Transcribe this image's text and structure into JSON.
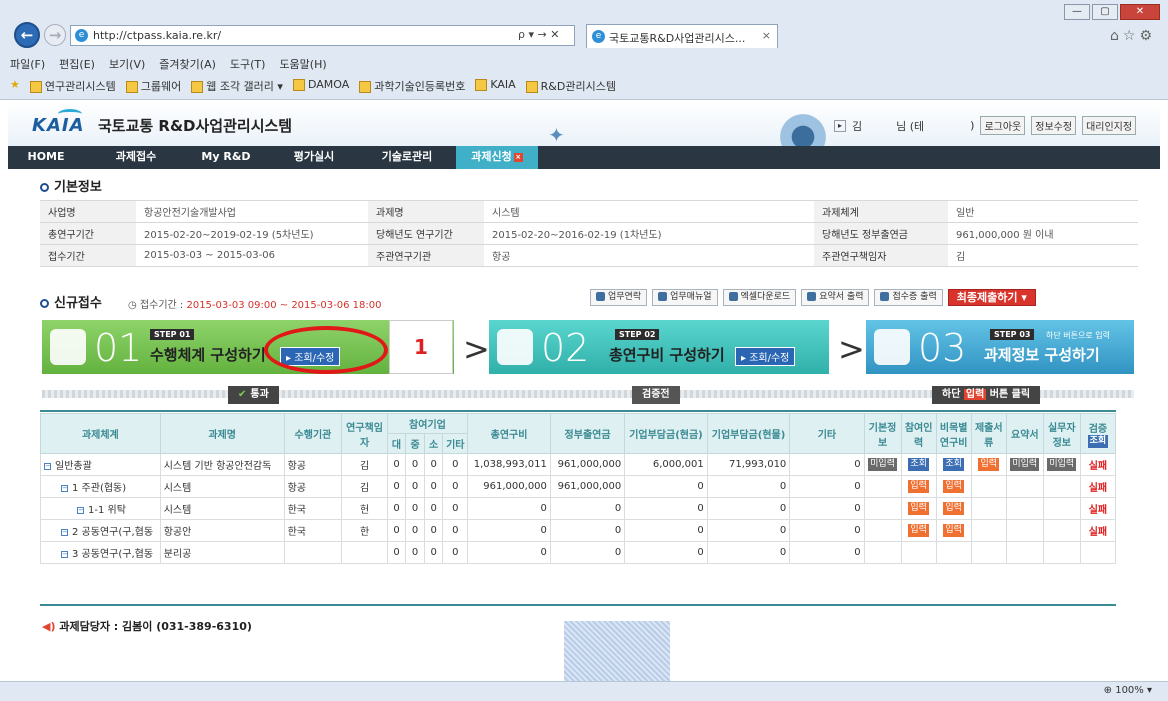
{
  "browser": {
    "url": "http://ctpass.kaia.re.kr/",
    "addr_tools": "ρ ▾ → ✕",
    "tab_title": "국토교통R&D사업관리시스...",
    "menu": [
      "파일(F)",
      "편집(E)",
      "보기(V)",
      "즐겨찾기(A)",
      "도구(T)",
      "도움말(H)"
    ],
    "favorites": [
      "연구관리시스템",
      "그룹웨어",
      "웹 조각 갤러리 ▾",
      "DAMOA",
      "과학기술인등록번호",
      "KAIA",
      "R&D관리시스템"
    ],
    "zoom": "100%"
  },
  "site": {
    "logo": "KAIA",
    "title": "국토교통 R&D사업관리시스템",
    "user_prefix": "김",
    "user_suffix": "님 (테",
    "user_close": ")",
    "logout": "로그아웃",
    "edit_info": "정보수정",
    "proxy": "대리인지정"
  },
  "nav": [
    "HOME",
    "과제접수",
    "My R&D",
    "평가실시",
    "기술로관리",
    "과제신청"
  ],
  "basic_info": {
    "heading": "기본정보",
    "rows": [
      [
        "사업명",
        "항공안전기술개발사업",
        "과제명",
        "시스템",
        "과제체계",
        "일반"
      ],
      [
        "총연구기간",
        "2015-02-20~2019-02-19 (5차년도)",
        "당해년도 연구기간",
        "2015-02-20~2016-02-19 (1차년도)",
        "당해년도 정부출연금",
        "961,000,000 원 이내"
      ],
      [
        "접수기간",
        "2015-03-03 ~ 2015-03-06",
        "주관연구기관",
        "항공",
        "주관연구책임자",
        "김"
      ]
    ]
  },
  "new_submission": {
    "heading": "신규접수",
    "period_label": "접수기간 :",
    "period_value": "2015-03-03 09:00 ~ 2015-03-06 18:00",
    "tools": [
      "업무연락",
      "업무매뉴얼",
      "엑셀다운로드",
      "요약서 출력",
      "접수증 출력"
    ],
    "final_submit": "최종제출하기"
  },
  "steps": [
    {
      "num": "01",
      "tag": "STEP 01",
      "title": "수행체계 구성하기",
      "button": "조회/수정",
      "status": "통과"
    },
    {
      "num": "02",
      "tag": "STEP 02",
      "title": "총연구비 구성하기",
      "button": "조회/수정",
      "status": "검증전"
    },
    {
      "num": "03",
      "tag": "STEP 03",
      "tag_note": "하단 버튼으로 입력",
      "title": "과제정보 구성하기",
      "status_pre": "하단",
      "status_mid": "입력",
      "status_post": "버튼 클릭"
    }
  ],
  "annotation_number": "1",
  "table": {
    "headers": [
      "과제체계",
      "과제명",
      "수행기관",
      "연구책임자",
      "참여기업",
      "총연구비",
      "정부출연금",
      "기업부담금(현금)",
      "기업부담금(현물)",
      "기타",
      "기본정보",
      "참여인력",
      "비목별연구비",
      "제출서류",
      "요약서",
      "실무자정보",
      "검증"
    ],
    "sub_headers": [
      "대",
      "중",
      "소",
      "기타"
    ],
    "verify_btn": "조회",
    "rows": [
      {
        "tree": "일반총괄",
        "name": "시스템 기반 항공안전감독",
        "org": "항공",
        "lead": "김",
        "b": "0",
        "m": "0",
        "s": "0",
        "e": "0",
        "total": "1,038,993,011",
        "gov": "961,000,000",
        "cash": "6,000,001",
        "inkind": "71,993,010",
        "etc": "0",
        "c1": "미입력",
        "c2": "조회",
        "c3": "조회",
        "c4": "입력",
        "c5": "미입력",
        "c6": "미입력",
        "verify": "실패"
      },
      {
        "tree": "1 주관(협동)",
        "name": "시스템",
        "org": "항공",
        "lead": "김",
        "b": "0",
        "m": "0",
        "s": "0",
        "e": "0",
        "total": "961,000,000",
        "gov": "961,000,000",
        "cash": "0",
        "inkind": "0",
        "etc": "0",
        "c2": "입력",
        "c3": "입력",
        "verify": "실패"
      },
      {
        "tree": "1-1 위탁",
        "name": "시스템",
        "org": "한국",
        "lead": "헌",
        "b": "0",
        "m": "0",
        "s": "0",
        "e": "0",
        "total": "0",
        "gov": "0",
        "cash": "0",
        "inkind": "0",
        "etc": "0",
        "c2": "입력",
        "c3": "입력",
        "verify": "실패"
      },
      {
        "tree": "2 공동연구(구,협동",
        "name": "항공안",
        "org": "한국",
        "lead": "한",
        "b": "0",
        "m": "0",
        "s": "0",
        "e": "0",
        "total": "0",
        "gov": "0",
        "cash": "0",
        "inkind": "0",
        "etc": "0",
        "c2": "입력",
        "c3": "입력",
        "verify": "실패"
      },
      {
        "tree": "3 공동연구(구,협동",
        "name": "분리공",
        "org": "",
        "lead": "",
        "b": "0",
        "m": "0",
        "s": "0",
        "e": "0",
        "total": "0",
        "gov": "0",
        "cash": "0",
        "inkind": "0",
        "etc": "0"
      }
    ]
  },
  "manager": "과제담당자 : 김봄이 (031-389-6310)"
}
